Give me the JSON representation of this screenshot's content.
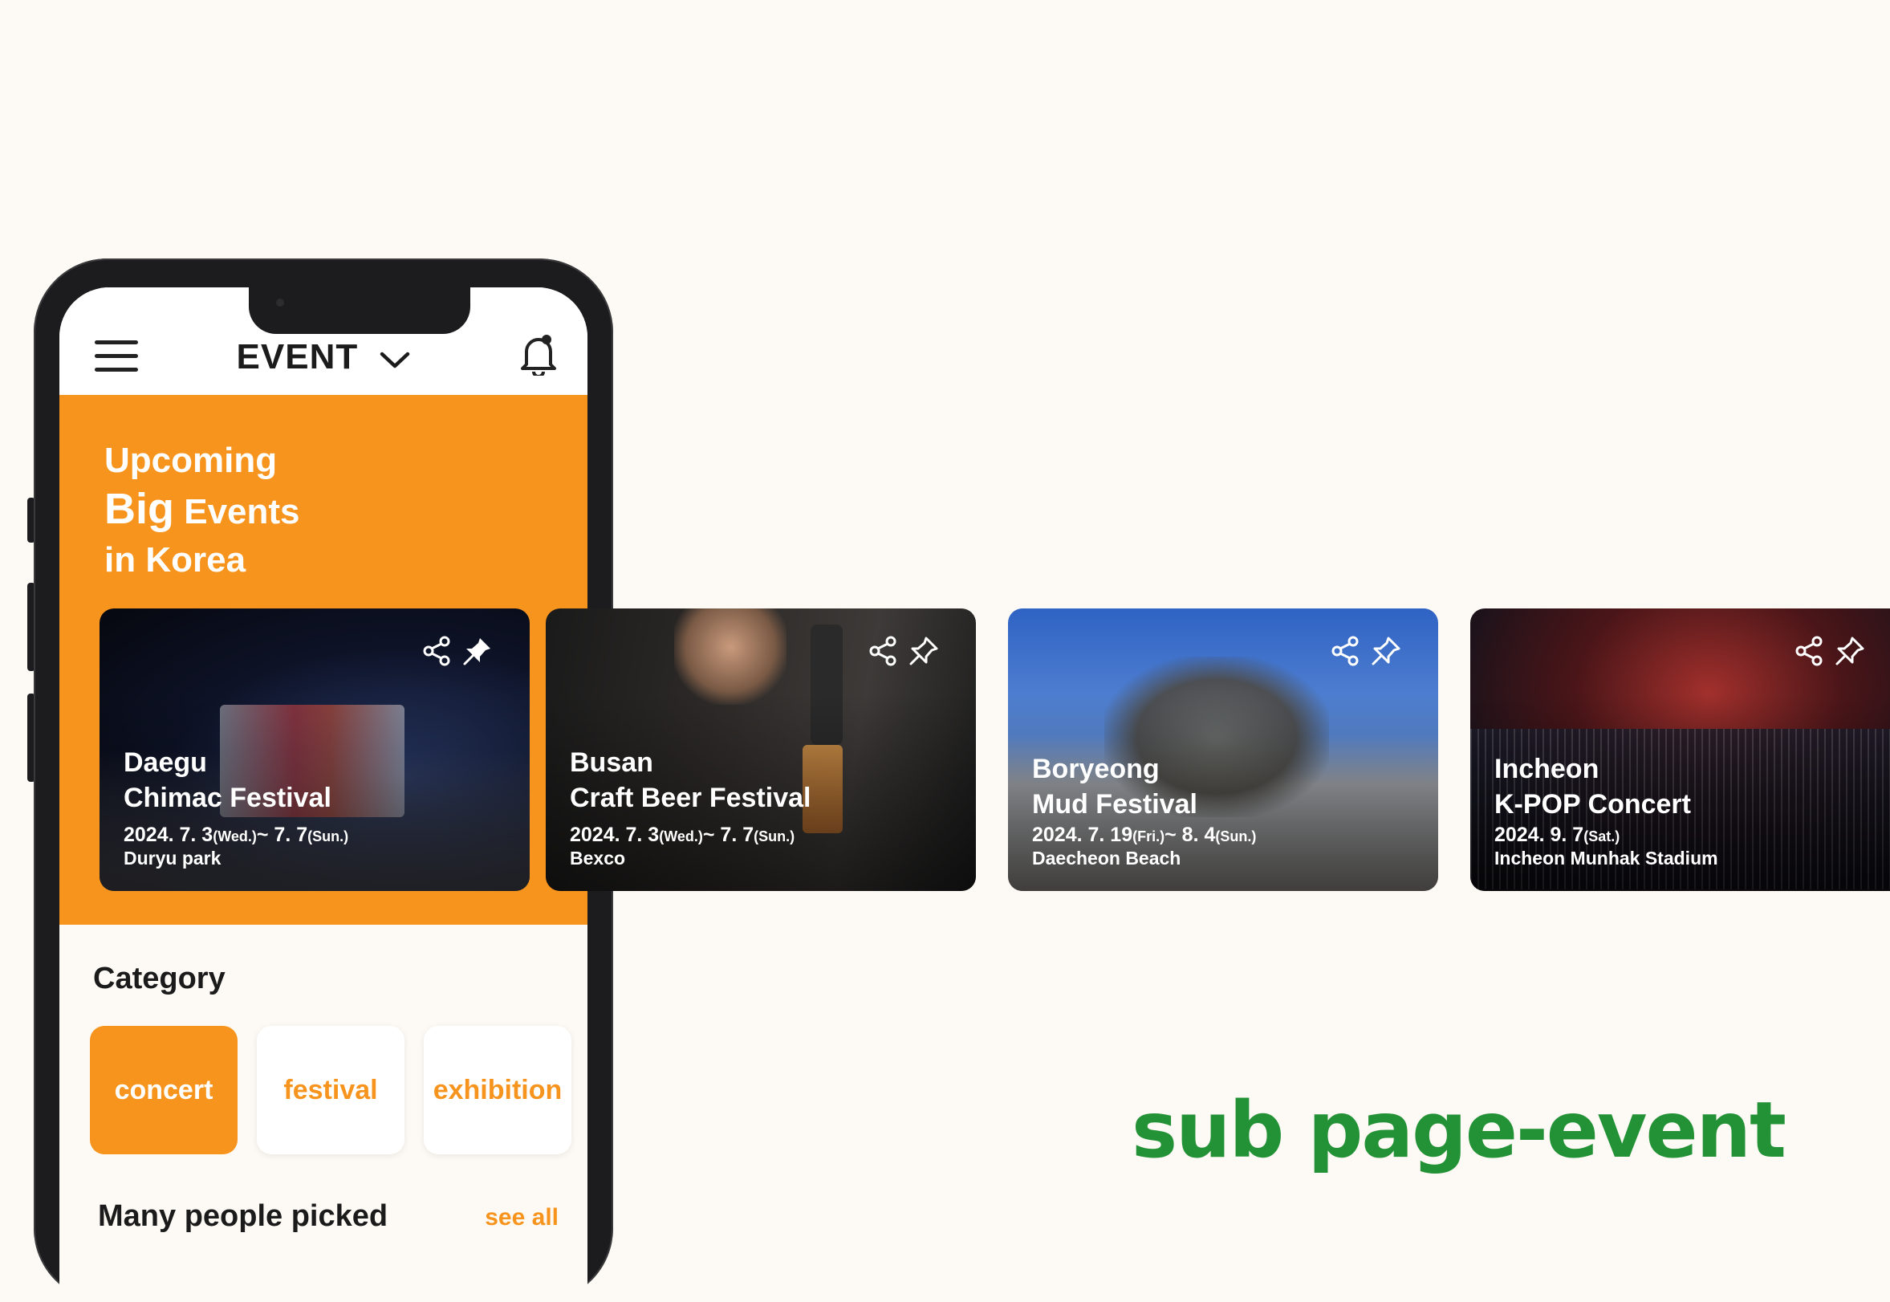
{
  "app": {
    "title": "EVENT",
    "menu_icon": "hamburger-menu-icon",
    "dropdown_icon": "chevron-down-icon",
    "bell_icon": "bell-icon"
  },
  "hero": {
    "line1": "Upcoming",
    "line2_big": "Big",
    "line2_rest": "Events",
    "line3": "in Korea"
  },
  "cards": [
    {
      "line1": "Daegu",
      "line2": "Chimac Festival",
      "date_a": "2024. 7. 3",
      "day_a": "(Wed.)",
      "date_b": "~ 7. 7",
      "day_b": "(Sun.)",
      "venue": "Duryu park"
    },
    {
      "line1": "Busan",
      "line2": "Craft Beer Festival",
      "date_a": "2024. 7. 3",
      "day_a": "(Wed.)",
      "date_b": "~ 7. 7",
      "day_b": "(Sun.)",
      "venue": "Bexco"
    },
    {
      "line1": "Boryeong",
      "line2": "Mud Festival",
      "date_a": "2024. 7. 19",
      "day_a": "(Fri.)",
      "date_b": "~ 8. 4",
      "day_b": "(Sun.)",
      "venue": "Daecheon Beach"
    },
    {
      "line1": "Incheon",
      "line2": "K-POP Concert",
      "date_a": "2024. 9. 7",
      "day_a": "(Sat.)",
      "date_b": "",
      "day_b": "",
      "venue": "Incheon Munhak Stadium"
    }
  ],
  "category": {
    "heading": "Category",
    "items": [
      "concert",
      "festival",
      "exhibition"
    ],
    "active": "concert"
  },
  "picked": {
    "heading": "Many people picked",
    "see_all": "see all"
  },
  "caption": "sub page-event",
  "colors": {
    "accent": "#f7941d",
    "background": "#fdf9f4",
    "caption": "#239236"
  }
}
